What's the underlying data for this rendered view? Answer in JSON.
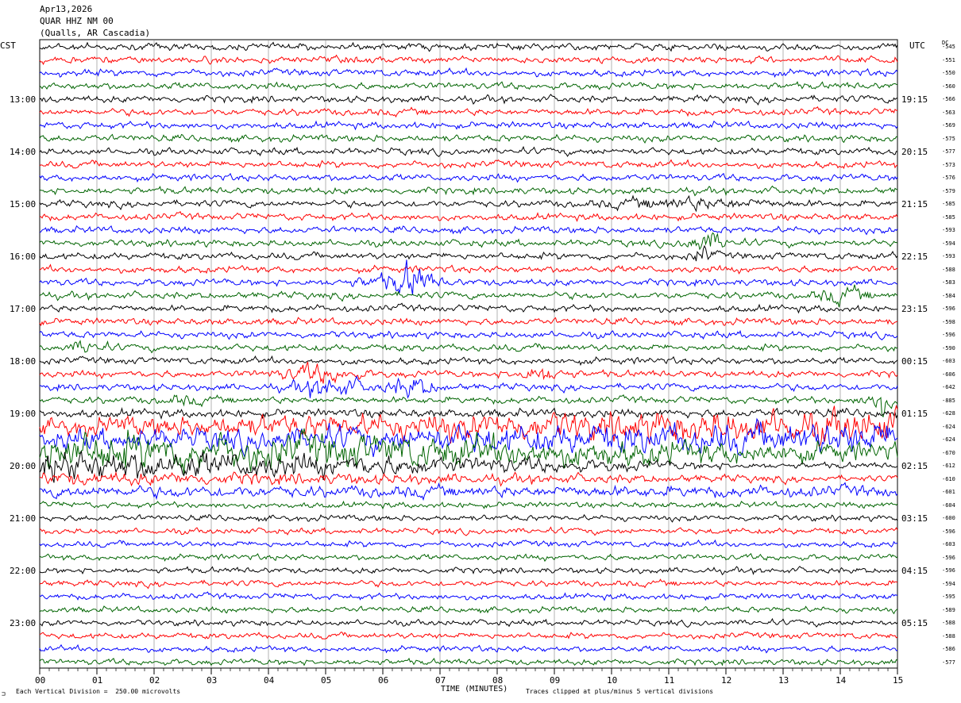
{
  "header": {
    "date": "Apr13,2026",
    "station": "QUAR HHZ NM 00",
    "location": "(Qualls, AR Cascadia)"
  },
  "left_tz": "CST",
  "right_tz": "UTC",
  "dc_label": "DC",
  "footer": {
    "scale": "Each Vertical Division =  250.00 microvolts",
    "clip": "Traces clipped at plus/minus 5 vertical divisions",
    "corner": "⊐"
  },
  "colors": {
    "black": "#000000",
    "red": "#ff0000",
    "blue": "#0000ff",
    "green": "#006400"
  },
  "chart_data": {
    "type": "line",
    "title": "QUAR HHZ NM 00",
    "xlabel": "TIME (MINUTES)",
    "ylabel": "",
    "x_ticks": [
      "00",
      "01",
      "02",
      "03",
      "04",
      "05",
      "06",
      "07",
      "08",
      "09",
      "10",
      "11",
      "12",
      "13",
      "14",
      "15"
    ],
    "xlim": [
      0,
      15
    ],
    "grid": true,
    "left_time_labels": [
      "13:00",
      "14:00",
      "15:00",
      "16:00",
      "17:00",
      "18:00",
      "19:00",
      "20:00",
      "21:00",
      "22:00",
      "23:00"
    ],
    "right_time_labels": [
      "19:15",
      "20:15",
      "21:15",
      "22:15",
      "23:15",
      "00:15",
      "01:15",
      "02:15",
      "03:15",
      "04:15",
      "05:15"
    ],
    "trace_colors": [
      "black",
      "red",
      "blue",
      "green"
    ],
    "dc_offsets": [
      -545,
      -551,
      -550,
      -560,
      -566,
      -563,
      -569,
      -575,
      -577,
      -573,
      -576,
      -579,
      -585,
      -585,
      -593,
      -594,
      -593,
      -588,
      -583,
      -584,
      -596,
      -598,
      -596,
      -590,
      -603,
      -606,
      -642,
      -885,
      -628,
      -624,
      -624,
      -670,
      -612,
      -610,
      -601,
      -604,
      -600,
      -596,
      -603,
      -596,
      -596,
      -594,
      -595,
      -589,
      -588,
      -588,
      -586,
      -577
    ]
  }
}
